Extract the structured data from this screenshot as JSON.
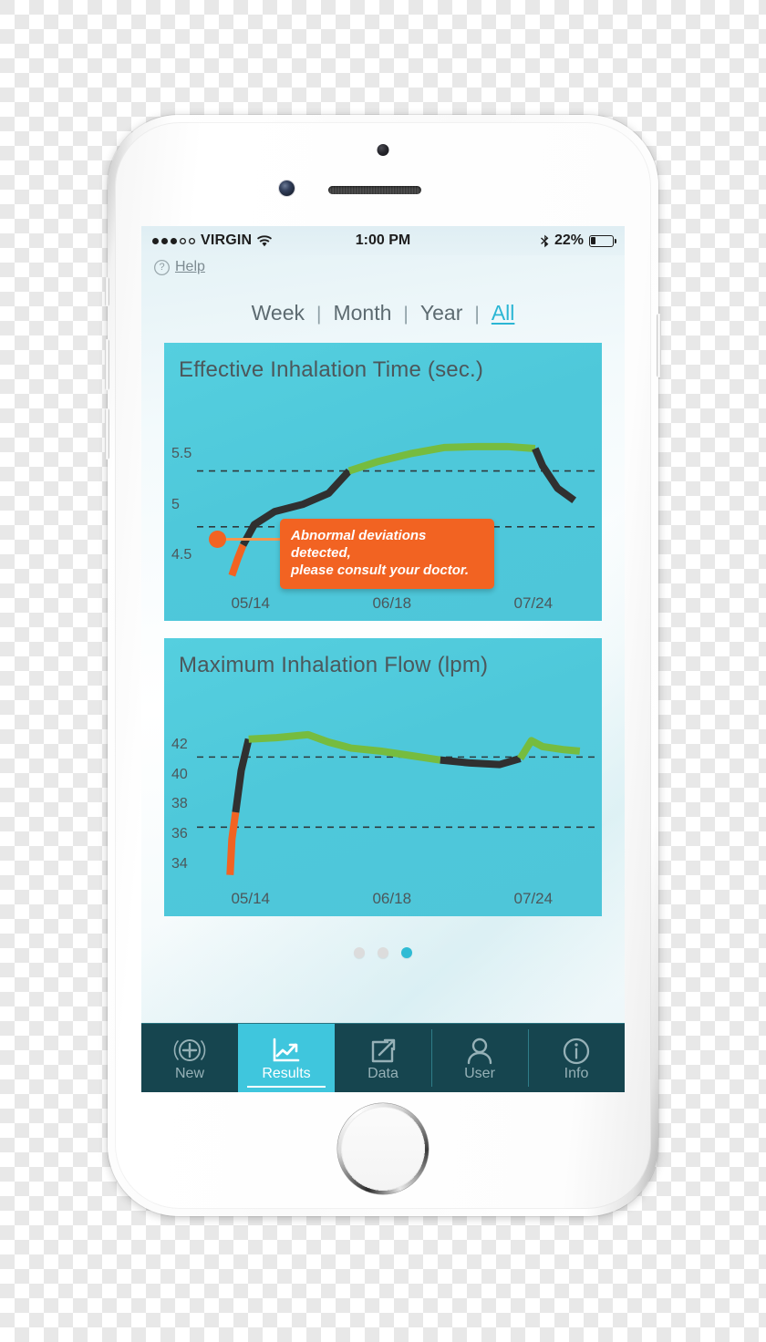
{
  "device": {
    "name": "white-smartphone"
  },
  "status_bar": {
    "signal_dots_filled": 3,
    "signal_dots_total": 5,
    "carrier": "VIRGIN",
    "wifi_icon": "wifi-icon",
    "time": "1:00 PM",
    "bluetooth_icon": "bluetooth-icon",
    "battery_percent": "22%",
    "battery_level": 22
  },
  "help": {
    "icon": "question-mark-icon",
    "label": "Help"
  },
  "period_filter": {
    "separator": "|",
    "options": [
      "Week",
      "Month",
      "Year",
      "All"
    ],
    "selected": "All"
  },
  "tooltip": {
    "line1": "Abnormal deviations detected,",
    "line2": "please consult your doctor."
  },
  "page_indicator": {
    "total": 3,
    "active_index": 2
  },
  "tab_bar": {
    "items": [
      {
        "label": "New",
        "icon": "plus-circle-icon",
        "active": false
      },
      {
        "label": "Results",
        "icon": "line-chart-icon",
        "active": true
      },
      {
        "label": "Data",
        "icon": "share-box-icon",
        "active": false
      },
      {
        "label": "User",
        "icon": "person-icon",
        "active": false
      },
      {
        "label": "Info",
        "icon": "info-circle-icon",
        "active": false
      }
    ]
  },
  "colors": {
    "chart_background": "#4EC8DA",
    "accent_teal": "#3FC6DD",
    "tabbar_dark": "#16454F",
    "alert_orange": "#F26322",
    "series_green": "#76BC3F",
    "series_dark": "#303030",
    "axis_text": "#4C575B"
  },
  "chart_data": [
    {
      "type": "line",
      "title": "Effective Inhalation Time (sec.)",
      "xlabel": "",
      "ylabel": "sec.",
      "ylim": [
        4.25,
        5.75
      ],
      "yticks": [
        5.5,
        5,
        4.5
      ],
      "ytick_labels": [
        "5.5",
        "5",
        "4.5"
      ],
      "reference_lines": [
        5.35,
        4.8
      ],
      "grid": "dashed-horizontal",
      "xtick_labels": [
        "05/14",
        "06/18",
        "07/24"
      ],
      "xtick_positions": [
        0.09,
        0.47,
        0.85
      ],
      "x": [
        0.04,
        0.055,
        0.07,
        0.1,
        0.155,
        0.23,
        0.3,
        0.355,
        0.43,
        0.52,
        0.61,
        0.7,
        0.78,
        0.855,
        0.875,
        0.915,
        0.96
      ],
      "values": [
        4.32,
        4.48,
        4.62,
        4.82,
        4.95,
        5.02,
        5.13,
        5.35,
        5.44,
        5.52,
        5.58,
        5.59,
        5.59,
        5.57,
        5.4,
        5.18,
        5.06
      ],
      "segment_colors": [
        "#F26322",
        "#303030",
        "#76BC3F",
        "#303030"
      ],
      "alert_point": {
        "x": 0.055,
        "y": 4.52
      },
      "annotation": "Abnormal deviations detected, please consult your doctor."
    },
    {
      "type": "line",
      "title": "Maximum Inhalation Flow (lpm)",
      "xlabel": "",
      "ylabel": "lpm",
      "ylim": [
        33.2,
        43.4
      ],
      "yticks": [
        42,
        40,
        38,
        36,
        34
      ],
      "ytick_labels": [
        "42",
        "40",
        "38",
        "36",
        "34"
      ],
      "reference_lines": [
        41.3,
        36.6
      ],
      "grid": "dashed-horizontal",
      "xtick_labels": [
        "05/14",
        "06/18",
        "07/24"
      ],
      "xtick_positions": [
        0.09,
        0.47,
        0.85
      ],
      "x": [
        0.035,
        0.04,
        0.05,
        0.065,
        0.085,
        0.16,
        0.245,
        0.3,
        0.36,
        0.44,
        0.52,
        0.6,
        0.68,
        0.76,
        0.815,
        0.845,
        0.875,
        0.93,
        0.975
      ],
      "values": [
        33.4,
        35.8,
        37.6,
        40.4,
        42.5,
        42.6,
        42.8,
        42.3,
        41.9,
        41.7,
        41.4,
        41.1,
        40.9,
        40.8,
        41.2,
        42.4,
        42.0,
        41.8,
        41.7
      ],
      "segment_colors": [
        "#F26322",
        "#303030",
        "#76BC3F",
        "#303030",
        "#76BC3F"
      ]
    }
  ]
}
